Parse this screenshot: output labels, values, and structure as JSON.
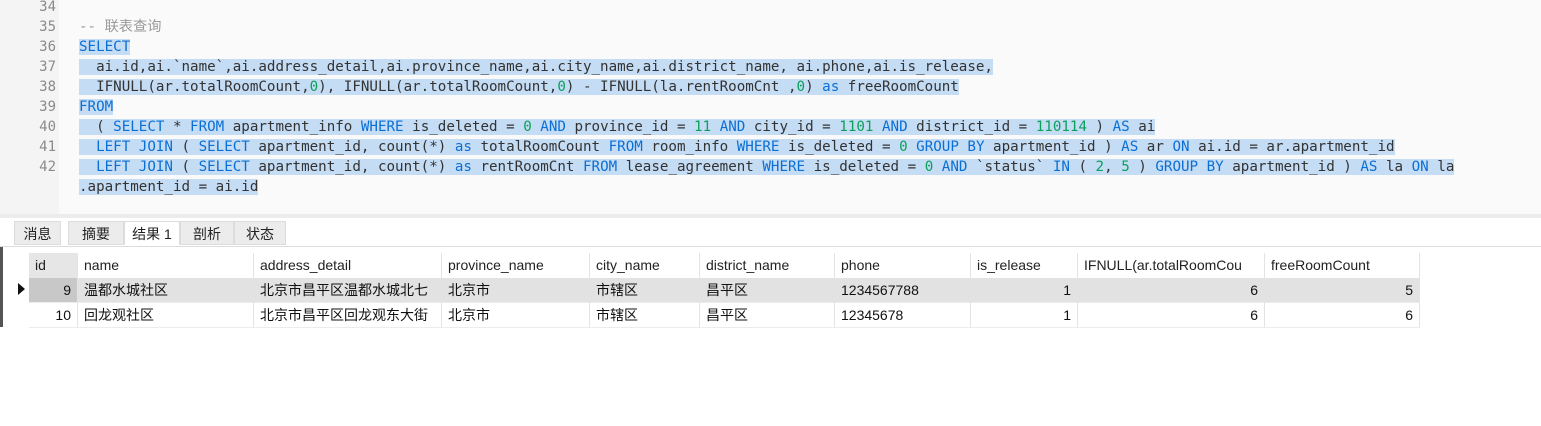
{
  "editor": {
    "line_numbers": [
      "34",
      "35",
      "36",
      "37",
      "38",
      "39",
      "40",
      "41",
      "42"
    ],
    "comment": "-- 联表查询",
    "l36": "SELECT",
    "l37": "  ai.id,ai.`name`,ai.address_detail,ai.province_name,ai.city_name,ai.district_name, ai.phone,ai.is_release,",
    "l38_a": "  IFNULL(ar.totalRoomCount,",
    "l38_b": "0",
    "l38_c": "), IFNULL(ar.totalRoomCount,",
    "l38_d": "0",
    "l38_e": ") - IFNULL(la.rentRoomCnt ,",
    "l38_f": "0",
    "l38_g": ") ",
    "l38_h": "as",
    "l38_i": " freeRoomCount",
    "l39": "FROM",
    "l40": {
      "a": "  ( ",
      "b": "SELECT",
      "c": " * ",
      "d": "FROM",
      "e": " apartment_info ",
      "f": "WHERE",
      "g": " is_deleted = ",
      "h": "0",
      "i": " ",
      "j": "AND",
      "k": " province_id = ",
      "l": "11",
      "m": " ",
      "n": "AND",
      "o": " city_id = ",
      "p": "1101",
      "q": " ",
      "r": "AND",
      "s": " district_id = ",
      "t": "110114",
      "u": " ) ",
      "v": "AS",
      "w": " ai"
    },
    "l41": {
      "a": "  ",
      "b": "LEFT JOIN",
      "c": " ( ",
      "d": "SELECT",
      "e": " apartment_id, count(*) ",
      "f": "as",
      "g": " totalRoomCount ",
      "h": "FROM",
      "i": " room_info ",
      "j": "WHERE",
      "k": " is_deleted = ",
      "l": "0",
      "m": " ",
      "n": "GROUP BY",
      "o": " apartment_id ) ",
      "p": "AS",
      "q": " ar ",
      "r": "ON",
      "s": " ai.id = ar.apartment_id"
    },
    "l42": {
      "a": "  ",
      "b": "LEFT JOIN",
      "c": " ( ",
      "d": "SELECT",
      "e": " apartment_id, count(*) ",
      "f": "as",
      "g": " rentRoomCnt ",
      "h": "FROM",
      "i": " lease_agreement ",
      "j": "WHERE",
      "k": " is_deleted = ",
      "l": "0",
      "m": " ",
      "n": "AND",
      "o": " `status` ",
      "p": "IN",
      "q": " ( ",
      "r": "2",
      "s": ", ",
      "t": "5",
      "u": " ) ",
      "v": "GROUP BY",
      "w": " apartment_id ) ",
      "x": "AS",
      "y": " la ",
      "z": "ON",
      "z2": " la"
    },
    "l42_wrap": ".apartment_id = ai.id"
  },
  "tabs": [
    "消息",
    "摘要",
    "结果 1",
    "剖析",
    "状态"
  ],
  "table": {
    "columns": [
      "id",
      "name",
      "address_detail",
      "province_name",
      "city_name",
      "district_name",
      "phone",
      "is_release",
      "IFNULL(ar.totalRoomCou",
      "freeRoomCount"
    ],
    "rows": [
      [
        "9",
        "温都水城社区",
        "北京市昌平区温都水城北七",
        "北京市",
        "市辖区",
        "昌平区",
        "1234567788",
        "1",
        "6",
        "5"
      ],
      [
        "10",
        "回龙观社区",
        "北京市昌平区回龙观东大街",
        "北京市",
        "市辖区",
        "昌平区",
        "12345678",
        "1",
        "6",
        "6"
      ]
    ]
  }
}
